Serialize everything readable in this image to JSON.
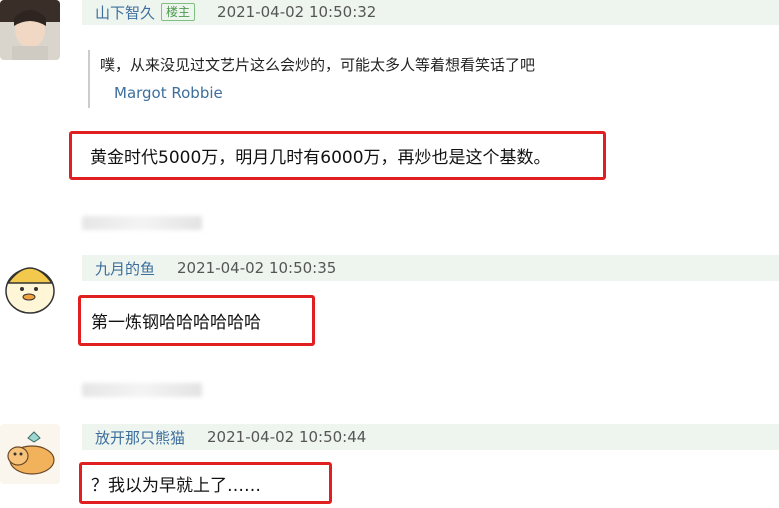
{
  "comments": [
    {
      "username": "山下智久",
      "badge": "楼主",
      "time": "2021-04-02 10:50:32",
      "quote": {
        "text": "噗，从来没见过文艺片这么会炒的，可能太多人等着想看笑话了吧",
        "author": "Margot Robbie"
      },
      "content": "黄金时代5000万，明月几时有6000万，再炒也是这个基数。"
    },
    {
      "username": "九月的鱼",
      "time": "2021-04-02 10:50:35",
      "content": "第一炼钢哈哈哈哈哈哈"
    },
    {
      "username": "放开那只熊猫",
      "time": "2021-04-02 10:50:44",
      "content": "？我以为早就上了……"
    }
  ],
  "colors": {
    "highlight": "#e02020",
    "username": "#3d6e9c",
    "meta_bg": "#eef5ef",
    "badge": "#4d9a4d"
  }
}
